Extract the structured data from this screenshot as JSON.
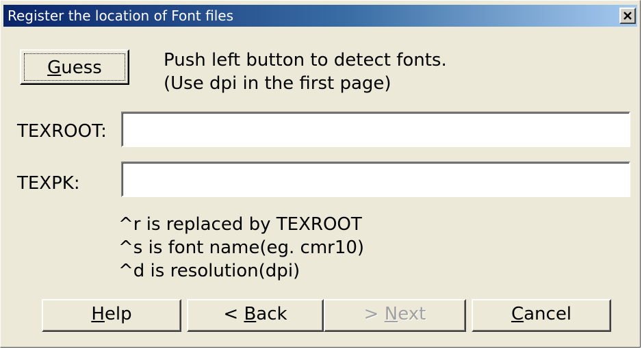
{
  "window": {
    "title": "Register the location of Font files",
    "close_glyph": "✕"
  },
  "guess": {
    "label_underline": "G",
    "label_rest": "uess",
    "hint_line1": "Push left button to detect fonts.",
    "hint_line2": "(Use dpi in the first page)"
  },
  "fields": {
    "texroot_label": "TEXROOT:",
    "texroot_value": "",
    "texpk_label": "TEXPK:",
    "texpk_value": ""
  },
  "notes": [
    "^r is replaced by TEXROOT",
    "^s is font name(eg. cmr10)",
    "^d is resolution(dpi)"
  ],
  "buttons": {
    "help_ul": "H",
    "help_rest": "elp",
    "back_prefix": "< ",
    "back_ul": "B",
    "back_rest": "ack",
    "next_prefix": "> ",
    "next_ul": "N",
    "next_rest": "ext",
    "cancel_ul": "C",
    "cancel_rest": "ancel"
  },
  "colors": {
    "titlebar_start": "#0a246a",
    "titlebar_end": "#a6caf0",
    "dialog_bg": "#ece9d8"
  }
}
